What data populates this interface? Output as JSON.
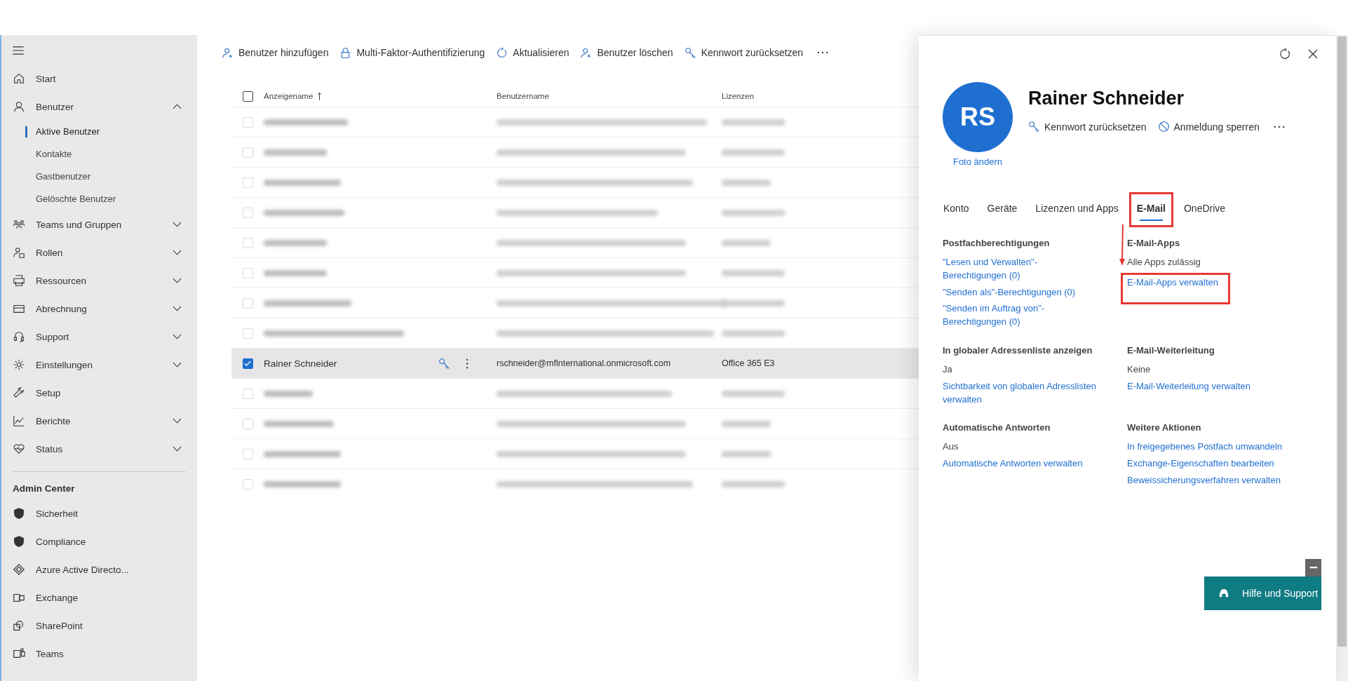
{
  "sidebar": {
    "items": [
      {
        "label": "Start"
      },
      {
        "label": "Benutzer",
        "expanded": true,
        "children": [
          {
            "label": "Aktive Benutzer",
            "selected": true
          },
          {
            "label": "Kontakte",
            "selected": false
          },
          {
            "label": "Gastbenutzer",
            "selected": false
          },
          {
            "label": "Gelöschte Benutzer",
            "selected": false
          }
        ]
      },
      {
        "label": "Teams und Gruppen",
        "expanded": false
      },
      {
        "label": "Rollen",
        "expanded": false
      },
      {
        "label": "Ressourcen",
        "expanded": false
      },
      {
        "label": "Abrechnung",
        "expanded": false
      },
      {
        "label": "Support",
        "expanded": false
      },
      {
        "label": "Einstellungen",
        "expanded": false
      },
      {
        "label": "Setup"
      },
      {
        "label": "Berichte",
        "expanded": false
      },
      {
        "label": "Status",
        "expanded": false
      }
    ],
    "admin_heading": "Admin Center",
    "admin_items": [
      {
        "label": "Sicherheit"
      },
      {
        "label": "Compliance"
      },
      {
        "label": "Azure Active Directo..."
      },
      {
        "label": "Exchange"
      },
      {
        "label": "SharePoint"
      },
      {
        "label": "Teams"
      }
    ]
  },
  "toolbar": [
    "Benutzer hinzufügen",
    "Multi-Faktor-Authentifizierung",
    "Aktualisieren",
    "Benutzer löschen",
    "Kennwort zurücksetzen"
  ],
  "table": {
    "all_selected": false,
    "columns": [
      "Anzeigename",
      "Benutzername",
      "Lizenzen"
    ],
    "rows": [
      {
        "kind": "blurred",
        "selected": false
      },
      {
        "kind": "blurred",
        "selected": false
      },
      {
        "kind": "blurred",
        "selected": false
      },
      {
        "kind": "blurred",
        "selected": false
      },
      {
        "kind": "blurred",
        "selected": false
      },
      {
        "kind": "blurred",
        "selected": false
      },
      {
        "kind": "blurred",
        "selected": false
      },
      {
        "kind": "blurred",
        "selected": false
      },
      {
        "kind": "user",
        "selected": true,
        "name": "Rainer Schneider",
        "username": "rschneider@mflnternational.onmicrosoft.com",
        "license": "Office 365 E3"
      },
      {
        "kind": "blurred",
        "selected": false
      },
      {
        "kind": "blurred",
        "selected": false
      },
      {
        "kind": "blurred",
        "selected": false
      },
      {
        "kind": "blurred",
        "selected": false
      }
    ]
  },
  "panel": {
    "initials": "RS",
    "name": "Rainer Schneider",
    "photo_link": "Foto ändern",
    "actions": [
      "Kennwort zurücksetzen",
      "Anmeldung sperren"
    ],
    "tabs": [
      {
        "label": "Konto",
        "selected": false
      },
      {
        "label": "Geräte",
        "selected": false
      },
      {
        "label": "Lizenzen und Apps",
        "selected": false
      },
      {
        "label": "E-Mail",
        "selected": true,
        "highlighted": true
      },
      {
        "label": "OneDrive",
        "selected": false
      }
    ],
    "sections": [
      {
        "heading": "Postfachberechtigungen",
        "links": [
          {
            "text": "\"Lesen und Verwalten\"-Berechtigungen (0)"
          },
          {
            "text": "\"Senden als\"-Berechtigungen (0)"
          },
          {
            "text": "\"Senden im Auftrag von\"-Berechtigungen (0)"
          }
        ]
      },
      {
        "heading": "E-Mail-Apps",
        "value": "Alle Apps zulässig",
        "links": [
          {
            "text": "E-Mail-Apps verwalten",
            "highlighted": true
          }
        ]
      },
      {
        "heading": "In globaler Adressenliste anzeigen",
        "value": "Ja",
        "links": [
          {
            "text": "Sichtbarkeit von globalen Adresslisten verwalten"
          }
        ]
      },
      {
        "heading": "E-Mail-Weiterleitung",
        "value": "Keine",
        "links": [
          {
            "text": "E-Mail-Weiterleitung verwalten"
          }
        ]
      },
      {
        "heading": "Automatische Antworten",
        "value": "Aus",
        "links": [
          {
            "text": "Automatische Antworten verwalten"
          }
        ]
      },
      {
        "heading": "Weitere Aktionen",
        "links": [
          {
            "text": "In freigegebenes Postfach umwandeln"
          },
          {
            "text": "Exchange-Eigenschaften bearbeiten"
          },
          {
            "text": "Beweissicherungsverfahren verwalten"
          }
        ]
      }
    ]
  },
  "help_button": "Hilfe und Support"
}
